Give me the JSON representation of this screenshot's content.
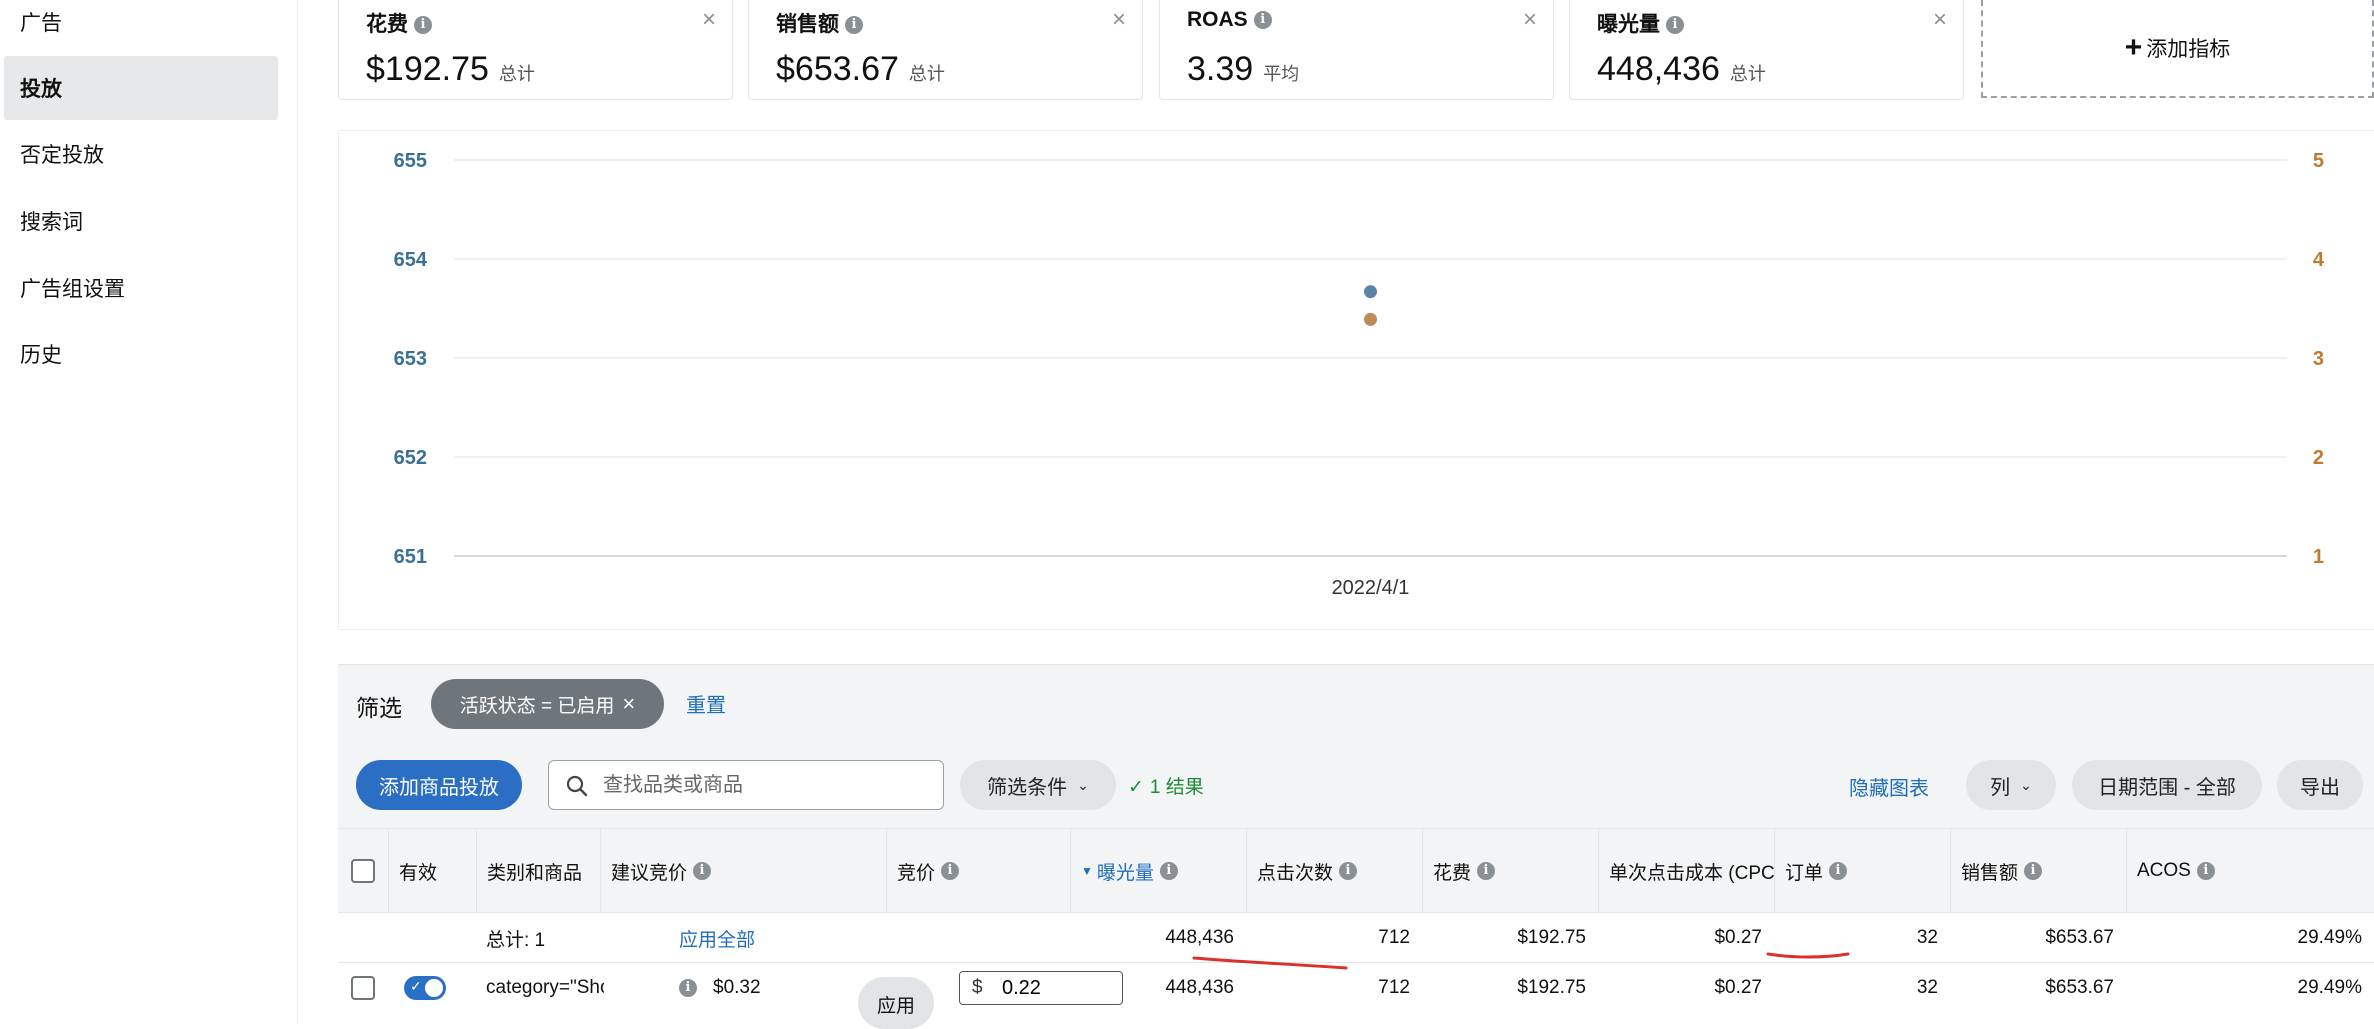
{
  "sidebar": {
    "items": [
      {
        "label": "广告"
      },
      {
        "label": "投放"
      },
      {
        "label": "否定投放"
      },
      {
        "label": "搜索词"
      },
      {
        "label": "广告组设置"
      },
      {
        "label": "历史"
      }
    ],
    "active_index": 1
  },
  "metrics": [
    {
      "name": "花费",
      "value": "$192.75",
      "sub": "总计"
    },
    {
      "name": "销售额",
      "value": "$653.67",
      "sub": "总计"
    },
    {
      "name": "ROAS",
      "value": "3.39",
      "sub": "平均"
    },
    {
      "name": "曝光量",
      "value": "448,436",
      "sub": "总计"
    }
  ],
  "add_metric_label": "添加指标",
  "chart_data": {
    "type": "scatter",
    "x_categories": [
      "2022/4/1"
    ],
    "y_left": {
      "ticks": [
        "655",
        "654",
        "653",
        "652",
        "651"
      ],
      "range": [
        651,
        655
      ],
      "color": "#3a6f96"
    },
    "y_right": {
      "ticks": [
        "5",
        "4",
        "3",
        "2",
        "1"
      ],
      "range": [
        1,
        5
      ],
      "color": "#c07a30"
    },
    "series": [
      {
        "axis": "left",
        "color": "#5b85a8",
        "points": [
          {
            "x": "2022/4/1",
            "y": 653.67
          }
        ]
      },
      {
        "axis": "right",
        "color": "#c08a58",
        "points": [
          {
            "x": "2022/4/1",
            "y": 3.39
          }
        ]
      }
    ],
    "grid": true
  },
  "filter": {
    "label": "筛选",
    "chip": "活跃状态 = 已启用",
    "reset": "重置"
  },
  "toolbar": {
    "add_button": "添加商品投放",
    "search_placeholder": "查找品类或商品",
    "filter_conditions": "筛选条件",
    "results": "1 结果",
    "hide_chart": "隐藏图表",
    "columns": "列",
    "date_range": "日期范围 - 全部",
    "export": "导出"
  },
  "table": {
    "headers": {
      "active": "有效",
      "category": "类别和商品",
      "suggested_bid": "建议竞价",
      "bid": "竞价",
      "impressions": "曝光量",
      "clicks": "点击次数",
      "spend": "花费",
      "cpc": "单次点击成本 (CPC)",
      "orders": "订单",
      "sales": "销售额",
      "acos": "ACOS"
    },
    "total_row": {
      "label": "总计: 1",
      "apply_all": "应用全部",
      "impressions": "448,436",
      "clicks": "712",
      "spend": "$192.75",
      "cpc": "$0.27",
      "orders": "32",
      "sales": "$653.67",
      "acos": "29.49%"
    },
    "rows": [
      {
        "category": "category=\"Show…",
        "suggested_bid": "$0.32",
        "apply": "应用",
        "bid_prefix": "$",
        "bid_value": "0.22",
        "impressions": "448,436",
        "clicks": "712",
        "spend": "$192.75",
        "cpc": "$0.27",
        "orders": "32",
        "sales": "$653.67",
        "acos": "29.49%"
      }
    ]
  },
  "colors": {
    "primary": "#2a6fc4",
    "link": "#1f6ebd",
    "annotation": "#d9312b"
  }
}
